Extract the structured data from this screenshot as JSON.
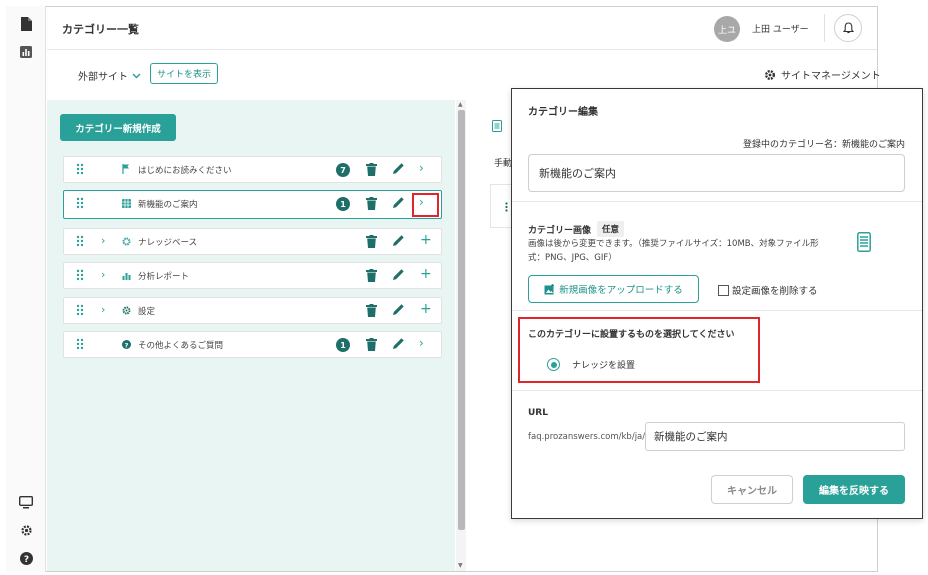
{
  "colors": {
    "accent": "#2aa198",
    "badge": "#1e6f6a",
    "highlight": "#e0262b",
    "panel_bg": "#e8f5f3"
  },
  "header": {
    "title": "カテゴリー一覧",
    "avatar_initials": "上ユ",
    "user_name": "上田 ユーザー"
  },
  "toolbar": {
    "site_select": "外部サイト",
    "show_site": "サイトを表示",
    "site_management": "サイトマネージメント"
  },
  "left_panel": {
    "new_category_button": "カテゴリー新規作成",
    "categories": [
      {
        "label": "はじめにお読みください",
        "icon": "flag-icon",
        "count": "7",
        "has_children": false,
        "selected": false
      },
      {
        "label": "新機能のご案内",
        "icon": "grid-icon",
        "count": "1",
        "has_children": false,
        "selected": true
      },
      {
        "label": "ナレッジベース",
        "icon": "gear-small-icon",
        "count": "",
        "has_children": true,
        "selected": false
      },
      {
        "label": "分析レポート",
        "icon": "chart-icon",
        "count": "",
        "has_children": true,
        "selected": false
      },
      {
        "label": "設定",
        "icon": "cog-icon",
        "count": "",
        "has_children": true,
        "selected": false
      },
      {
        "label": "その他よくあるご質問",
        "icon": "question-icon",
        "count": "1",
        "has_children": false,
        "selected": false
      }
    ]
  },
  "under_panel": {
    "text": "手動"
  },
  "modal": {
    "title": "カテゴリー編集",
    "current_name_label": "登録中のカテゴリー名：新機能のご案内",
    "name_value": "新機能のご案内",
    "image_label": "カテゴリー画像",
    "optional_tag": "任意",
    "image_note": "画像は後から変更できます。（推奨ファイルサイズ：10MB、対象ファイル形式：PNG、JPG、GIF）",
    "upload_button": "新規画像をアップロードする",
    "delete_image_label": "設定画像を削除する",
    "select_label": "このカテゴリーに設置するものを選択してください",
    "radio_option": "ナレッジを設置",
    "url_label": "URL",
    "url_prefix": "faq.prozanswers.com/kb/ja/",
    "url_value": "新機能のご案内",
    "cancel_button": "キャンセル",
    "apply_button": "編集を反映する"
  }
}
